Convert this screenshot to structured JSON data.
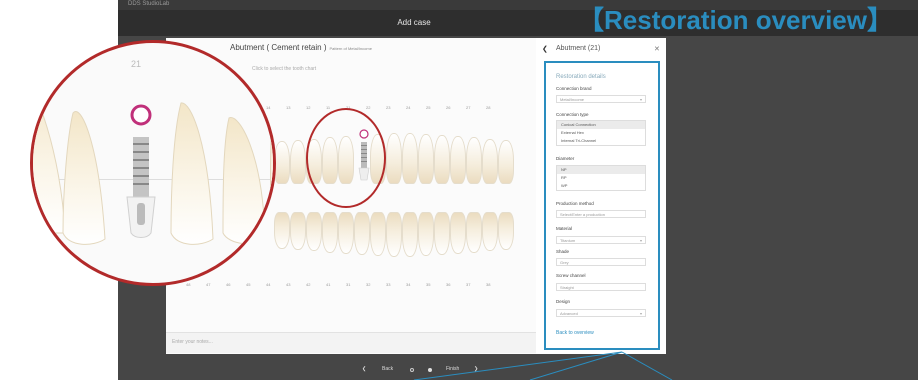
{
  "window": {
    "app_title": "DDS StudioLab"
  },
  "header": {
    "title": "Add case"
  },
  "heading_tag": {
    "open_bracket": "【",
    "text": "Restoration overview",
    "close_bracket": "】"
  },
  "card": {
    "tooth_number": "21",
    "title": "Abutment ( Cement retain )",
    "subtitle": "Pattern of Metal/Income",
    "chart_hint": "Click to select the tooth chart",
    "upper_numbers": [
      "18",
      "17",
      "16",
      "15",
      "14",
      "13",
      "12",
      "11",
      "21",
      "22",
      "23",
      "24",
      "25",
      "26",
      "27",
      "28"
    ],
    "lower_numbers": [
      "48",
      "47",
      "46",
      "45",
      "44",
      "43",
      "42",
      "41",
      "31",
      "32",
      "33",
      "34",
      "35",
      "36",
      "37",
      "38"
    ],
    "note_placeholder": "Enter your notes..."
  },
  "panel": {
    "title": "Abutment (21)",
    "details_title": "Restoration details",
    "connection_brand_label": "Connection brand",
    "connection_brand_value": "Metal/Income",
    "connection_type_label": "Connection type",
    "connection_type_options": [
      "Conical Connection",
      "External Hex",
      "Internal Tri-Channel"
    ],
    "diameter_label": "Diameter",
    "diameter_options": [
      "NP",
      "RP",
      "WP"
    ],
    "production_method_label": "Production method",
    "production_method_value": "Select/Enter a production",
    "material_label": "Material",
    "material_value": "Titanium",
    "shade_label": "Shade",
    "shade_value": "Grey",
    "screw_channel_label": "Screw channel",
    "screw_channel_value": "Straight",
    "design_label": "Design",
    "design_value": "Advanced",
    "back_link": "Back to overview"
  },
  "footer": {
    "back": "Back",
    "finish": "Finish"
  },
  "colors": {
    "accent": "#2a8dbf",
    "highlight_circle": "#b22a2a",
    "implant_ring": "#c0307a"
  }
}
